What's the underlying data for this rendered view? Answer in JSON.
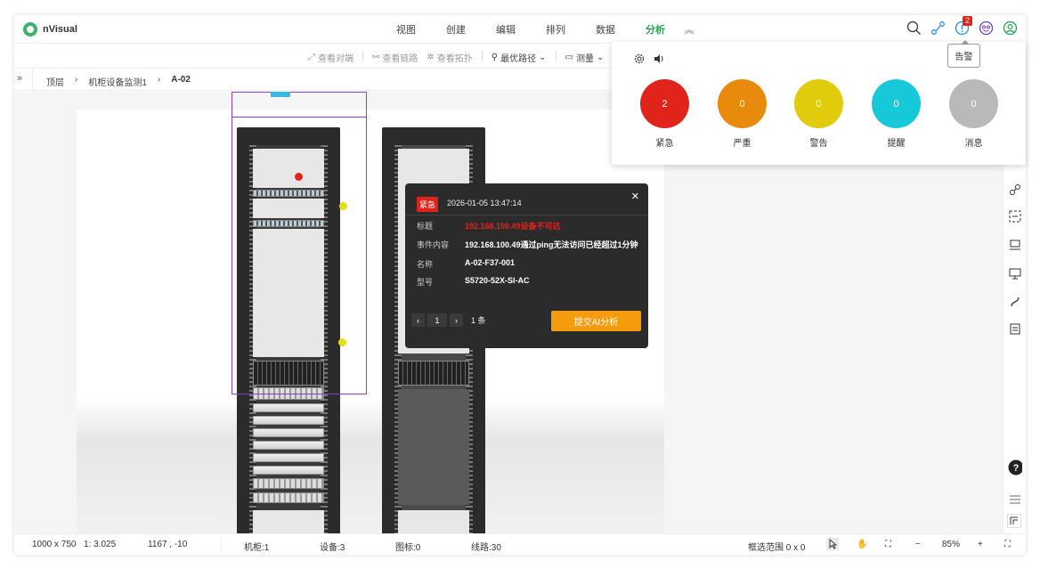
{
  "app": {
    "logo_text": "nVisual"
  },
  "menu": {
    "items": [
      "视图",
      "创建",
      "编辑",
      "排列",
      "数据",
      "分析"
    ],
    "active_index": 5,
    "accent": "#22a34a"
  },
  "topbar": {
    "alarm_badge": "2"
  },
  "toolbar": {
    "tools": [
      "查看对端",
      "查看链路",
      "查看拓扑",
      "最优路径",
      "测量"
    ]
  },
  "breadcrumb": {
    "items": [
      "顶层",
      "机柜设备监测1",
      "A-02"
    ]
  },
  "alarm_panel": {
    "levels": [
      {
        "label": "紧急",
        "count": "2",
        "color": "#e0241b"
      },
      {
        "label": "严重",
        "count": "0",
        "color": "#e88a0c"
      },
      {
        "label": "警告",
        "count": "0",
        "color": "#e0cb0c"
      },
      {
        "label": "提醒",
        "count": "0",
        "color": "#17c9d8"
      },
      {
        "label": "消息",
        "count": "0",
        "color": "#b9b9b9"
      }
    ]
  },
  "tooltip": {
    "text": "告警"
  },
  "alert_popup": {
    "level": "紧急",
    "time": "2026-01-05 13:47:14",
    "fields": [
      {
        "key": "标题",
        "value": "192.168.100.49设备不可达"
      },
      {
        "key": "事件内容",
        "value": "192.168.100.49通过ping无法访问已经超过1分钟"
      },
      {
        "key": "名称",
        "value": "A-02-F37-001"
      },
      {
        "key": "型号",
        "value": "S5720-52X-SI-AC"
      }
    ],
    "page": "1",
    "count": "1 条",
    "ai_button": "提交AI分析"
  },
  "statusbar": {
    "canvas_size": "1000 x 750",
    "scale": "1: 3.025",
    "coords": "1167 , -10",
    "racks": "机柜:1",
    "devices": "设备:3",
    "icons": "图标:0",
    "lines": "线路:30",
    "selection": "框选范围  0 x 0",
    "zoom": "85%"
  }
}
